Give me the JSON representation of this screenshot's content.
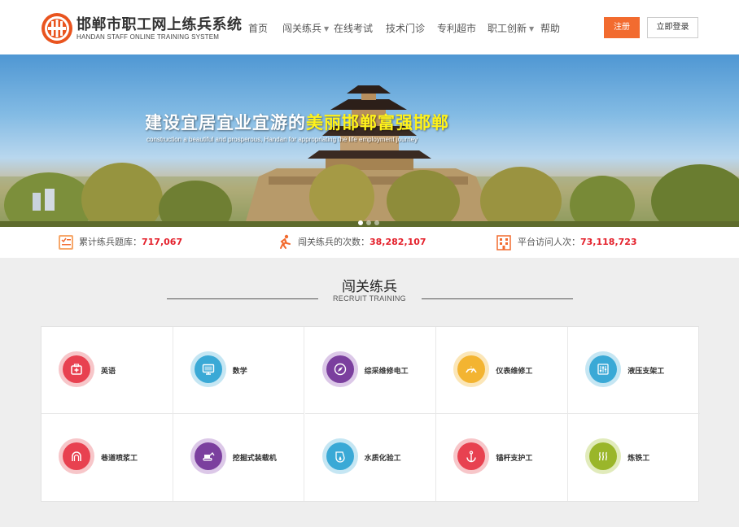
{
  "header": {
    "brand_title": "邯郸市职工网上练兵系统",
    "brand_subtitle": "HANDAN STAFF ONLINE TRAINING SYSTEM",
    "nav": [
      {
        "label": "首页",
        "has_dropdown": false
      },
      {
        "label": "闯关练兵",
        "has_dropdown": true
      },
      {
        "label": "在线考试",
        "has_dropdown": false
      },
      {
        "label": "技术门诊",
        "has_dropdown": false
      },
      {
        "label": "专利超市",
        "has_dropdown": false
      },
      {
        "label": "职工创新",
        "has_dropdown": true
      },
      {
        "label": "帮助",
        "has_dropdown": false
      }
    ],
    "register_label": "注册",
    "login_label": "立即登录",
    "accent_color": "#f26b2f"
  },
  "banner": {
    "title_part1": "建设宜居宜业宜游的",
    "title_highlight": "美丽邯郸富强邯郸",
    "subtitle": "construction a beautiful and prosperous, Handan for appropriating the life employment journey",
    "slide_count": 3,
    "active_slide": 1
  },
  "stats": [
    {
      "label": "累计练兵题库：",
      "value": "717,067",
      "icon": "exam-list-icon"
    },
    {
      "label": "闯关练兵的次数：",
      "value": "38,282,107",
      "icon": "running-icon"
    },
    {
      "label": "平台访问人次：",
      "value": "73,118,723",
      "icon": "building-icon"
    }
  ],
  "section": {
    "title": "闯关练兵",
    "subtitle": "RECRUIT TRAINING"
  },
  "categories": [
    {
      "label": "英语",
      "icon": "first-aid-kit-icon",
      "color": "#e84150",
      "ring": "#f7c6c9"
    },
    {
      "label": "数学",
      "icon": "monitor-icon",
      "color": "#3aa9d6",
      "ring": "#c5e6f3"
    },
    {
      "label": "综采维修电工",
      "icon": "compass-icon",
      "color": "#7b3f9e",
      "ring": "#dcc8e8"
    },
    {
      "label": "仪表维修工",
      "icon": "gauge-icon",
      "color": "#f3b431",
      "ring": "#fbe6b8"
    },
    {
      "label": "液压支架工",
      "icon": "sliders-icon",
      "color": "#3aa9d6",
      "ring": "#c5e6f3"
    },
    {
      "label": "巷道喷浆工",
      "icon": "tunnel-icon",
      "color": "#e84150",
      "ring": "#f7c6c9"
    },
    {
      "label": "挖掘式装载机",
      "icon": "excavator-icon",
      "color": "#7b3f9e",
      "ring": "#dcc8e8"
    },
    {
      "label": "水质化验工",
      "icon": "water-drop-icon",
      "color": "#3aa9d6",
      "ring": "#c5e6f3"
    },
    {
      "label": "锚杆支护工",
      "icon": "anchor-icon",
      "color": "#e84150",
      "ring": "#f7c6c9"
    },
    {
      "label": "炼铁工",
      "icon": "heat-waves-icon",
      "color": "#9ab62a",
      "ring": "#e1ebbb"
    }
  ]
}
